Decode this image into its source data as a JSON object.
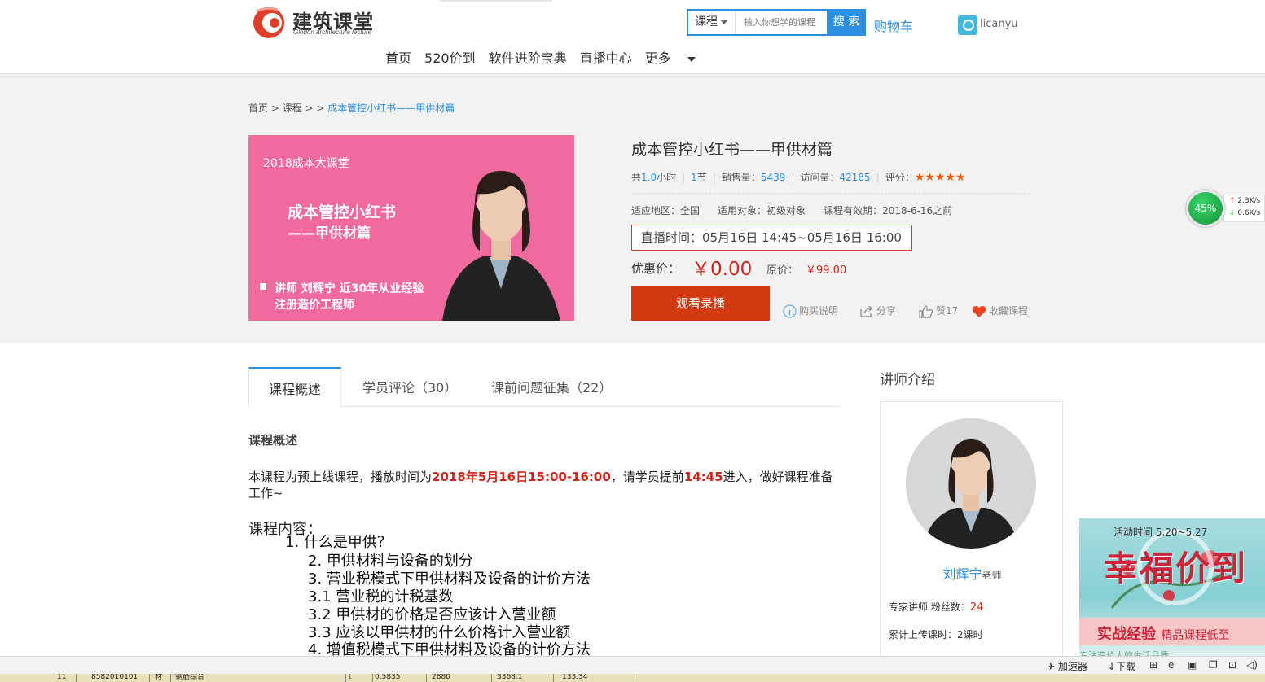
{
  "header": {
    "logo_text": "建筑课堂",
    "logo_sub": "Glodon architecture lecture",
    "search": {
      "category": "课程",
      "placeholder": "输入你想学的课程",
      "button": "搜 索"
    },
    "cart": "购物车",
    "username": "licanyu",
    "nav": [
      "首页",
      "520价到",
      "软件进阶宝典",
      "直播中心",
      "更多"
    ]
  },
  "breadcrumb": {
    "home": "首页",
    "sep1": " > ",
    "course": "课程",
    "sep2": " > > ",
    "current": "成本管控小红书——甲供材篇"
  },
  "cover": {
    "tag": "2018成本大课堂",
    "title1": "成本管控小红书",
    "title2": "——甲供材篇",
    "teacher_line1": "讲师 刘辉宁 近30年从业经验",
    "teacher_line2": "注册造价工程师"
  },
  "course": {
    "title": "成本管控小红书——甲供材篇",
    "hours_prefix": "共",
    "hours": "1.0",
    "hours_suffix": "小时",
    "sections": "1",
    "sections_suffix": "节",
    "sales_label": "销售量：",
    "sales": "5439",
    "visits_label": "访问量：",
    "visits": "42185",
    "rating_label": "评分：",
    "rating_stars": "★★★★★",
    "region_label": "适应地区：",
    "region": "全国",
    "audience_label": "适用对象：",
    "audience": "初级对象",
    "valid_label": "课程有效期：",
    "valid": "2018-6-16之前",
    "live_label": "直播时间：",
    "live_time": "05月16日 14:45~05月16日 16:00",
    "price_label": "优惠价：",
    "price": "￥0.00",
    "orig_label": "原价：",
    "orig_price": "￥99.00",
    "watch_button": "观看录播",
    "actions": {
      "buy_info": "购买说明",
      "share": "分享",
      "like": "赞17",
      "favorite": "收藏课程"
    }
  },
  "speed_widget": {
    "percent": "45%",
    "up": "2.3K/s",
    "down": "0.6K/s"
  },
  "tabs": [
    "课程概述",
    "学员评论（30）",
    "课前问题征集（22）"
  ],
  "overview": {
    "heading": "课程概述",
    "intro_a": "本课程为预上线课程，播放时间为",
    "intro_red1": "2018年5月16日15:00-16:00",
    "intro_b": "，请学员提前",
    "intro_red2": "14:45",
    "intro_c": "进入，做好课程准备工作~",
    "content_title": "课程内容：",
    "outline": [
      "1. 什么是甲供？",
      "2. 甲供材料与设备的划分",
      "3. 营业税模式下甲供材料及设备的计价方法",
      "3.1 营业税的计税基数",
      "3.2 甲供材的价格是否应该计入营业额",
      "3.3 应该以甲供材的什么价格计入营业额",
      "4. 增值税模式下甲供材料及设备的计价方法"
    ]
  },
  "teacher": {
    "heading": "讲师介绍",
    "name": "刘辉宁",
    "title_suffix": "老师",
    "fans_label": "专家讲师 粉丝数：",
    "fans": "24",
    "uploaded": "累计上传课时：2课时"
  },
  "promo": {
    "time": "活动时间  5.20~5.27",
    "big": "幸福价到",
    "strip_main": "实战经验",
    "strip_sub": "精品课程低至",
    "bottom": "专注造价人的生活品质"
  },
  "status_bar": {
    "accelerator": "加速器",
    "download": "下载"
  },
  "taskbar_cells": [
    "11",
    "8582010101",
    "材",
    "钢筋综合",
    "t",
    "0.5835",
    "2880",
    "3368.1",
    "133.34"
  ]
}
